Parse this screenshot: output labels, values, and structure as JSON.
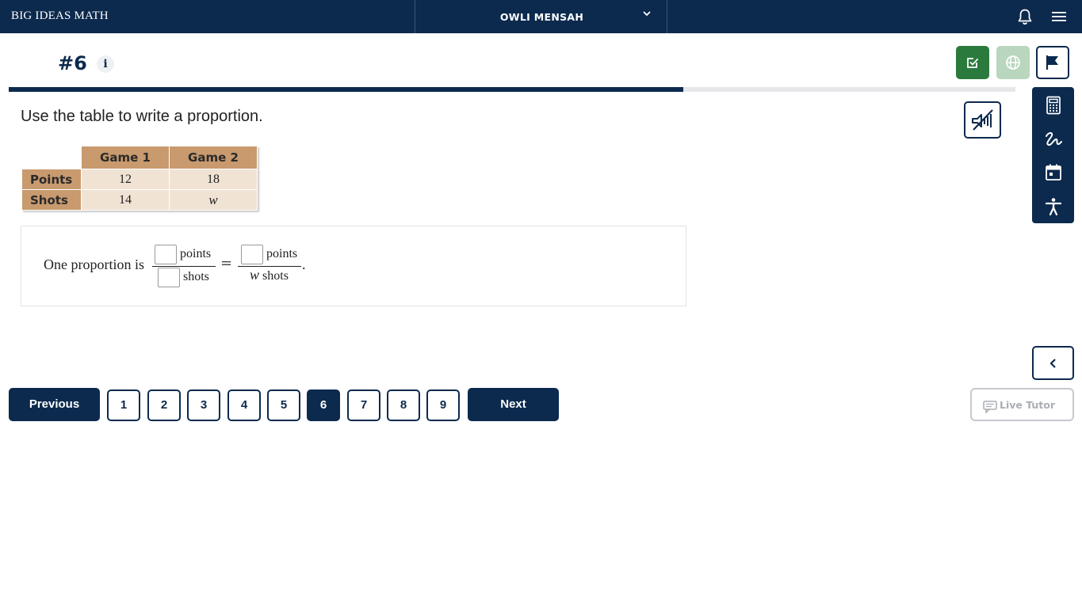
{
  "app": {
    "brand": "BIG IDEAS MATH"
  },
  "user": {
    "name": "OWLI MENSAH"
  },
  "question": {
    "number": "#6",
    "info_label": "i",
    "prompt": "Use the table to write a proportion.",
    "progress_percent": 67
  },
  "table": {
    "columns": [
      "Game 1",
      "Game 2"
    ],
    "rows": [
      {
        "label": "Points",
        "values": [
          "12",
          "18"
        ]
      },
      {
        "label": "Shots",
        "values": [
          "14",
          "w"
        ]
      }
    ]
  },
  "answer": {
    "lead": "One proportion is",
    "frac1_num_unit": "points",
    "frac1_den_unit": "shots",
    "equals": "=",
    "frac2_num_unit": "points",
    "frac2_den_var": "w",
    "frac2_den_unit": "shots",
    "end": "."
  },
  "pagination": {
    "previous_label": "Previous",
    "next_label": "Next",
    "pages": [
      "1",
      "2",
      "3",
      "4",
      "5",
      "6",
      "7",
      "8",
      "9"
    ],
    "current": "6"
  },
  "live_tutor": {
    "label": "Live Tutor"
  },
  "icons": {
    "chevron": "chevron-down-icon",
    "bell": "bell-icon",
    "menu": "hamburger-menu-icon",
    "check": "check-square-icon",
    "globe": "globe-icon",
    "flag": "flag-icon",
    "calculator": "calculator-icon",
    "scribble": "scribble-icon",
    "calendar": "calendar-icon",
    "accessibility": "accessibility-icon",
    "audio": "audio-muted-icon",
    "collapse": "chevron-left-icon",
    "chat": "chat-icon"
  },
  "colors": {
    "navy": "#0c2a4e",
    "green": "#2b7a3d",
    "green_disabled": "#b9d6bf",
    "table_header": "#c89a6e",
    "table_cell": "#f1e3d4"
  }
}
